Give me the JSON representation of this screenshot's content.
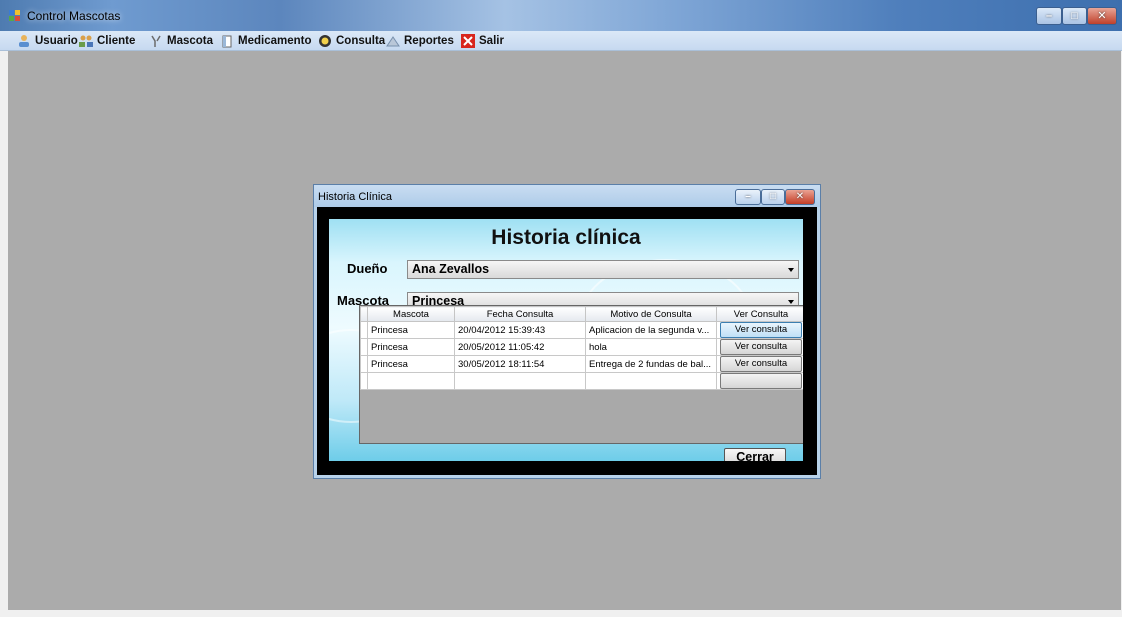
{
  "app": {
    "title": "Control Mascotas"
  },
  "menu": [
    {
      "label": "Usuario",
      "icon": "user-icon"
    },
    {
      "label": "Cliente",
      "icon": "clients-icon"
    },
    {
      "label": "Mascota",
      "icon": "pet-icon"
    },
    {
      "label": "Medicamento",
      "icon": "medicine-icon"
    },
    {
      "label": "Consulta",
      "icon": "consultation-icon"
    },
    {
      "label": "Reportes",
      "icon": "reports-icon"
    },
    {
      "label": "Salir",
      "icon": "exit-icon"
    }
  ],
  "child_window": {
    "title": "Historia Clínica",
    "heading": "Historia clínica",
    "owner_label": "Dueño",
    "owner_value": "Ana Zevallos",
    "pet_label": "Mascota",
    "pet_value": "Princesa",
    "close_button": "Cerrar",
    "grid": {
      "columns": [
        "Mascota",
        "Fecha Consulta",
        "Motivo de Consulta",
        "Ver Consulta"
      ],
      "rows": [
        [
          "Princesa",
          "20/04/2012 15:39:43",
          "Aplicacion de la segunda v...",
          "Ver consulta"
        ],
        [
          "Princesa",
          "20/05/2012 11:05:42",
          "hola",
          "Ver consulta"
        ],
        [
          "Princesa",
          "30/05/2012 18:11:54",
          "Entrega de 2 fundas de bal...",
          "Ver consulta"
        ],
        [
          "",
          "",
          "",
          ""
        ]
      ]
    }
  },
  "colors": {
    "mdi_background": "#ababab",
    "panel_accent": "#9fe0f3",
    "exit_red": "#d8261d"
  }
}
